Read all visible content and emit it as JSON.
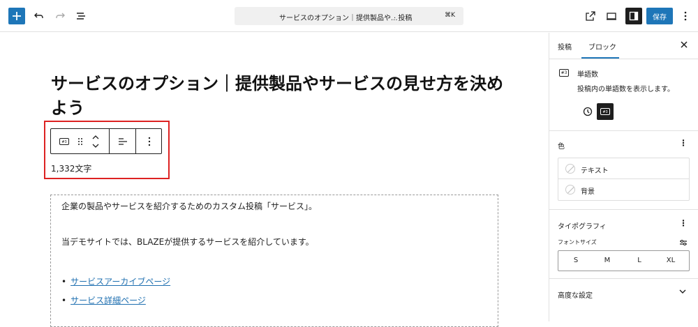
{
  "toolbar": {
    "document_title": "サービスのオプション｜提供製品や...",
    "document_type": "· 投稿",
    "shortcut": "⌘K",
    "save_label": "保存"
  },
  "editor": {
    "post_title": "サービスのオプション｜提供製品やサービスの見せ方を決めよう",
    "word_count": "1,332文字",
    "paragraphs": [
      "企業の製品やサービスを紹介するためのカスタム投稿「サービス」。",
      "当デモサイトでは、BLAZEが提供するサービスを紹介しています。"
    ],
    "list_items": [
      "サービスアーカイブページ",
      "サービス詳細ページ"
    ]
  },
  "sidebar": {
    "tabs": [
      "投稿",
      "ブロック"
    ],
    "active_tab": "ブロック",
    "block": {
      "title": "単語数",
      "description": "投稿内の単語数を表示します。"
    },
    "color": {
      "label": "色",
      "items": [
        "テキスト",
        "背景"
      ]
    },
    "typography": {
      "label": "タイポグラフィ",
      "font_size_label": "フォントサイズ",
      "sizes": [
        "S",
        "M",
        "L",
        "XL"
      ]
    },
    "advanced": {
      "label": "高度な設定"
    }
  },
  "colors": {
    "accent": "#1e76b8",
    "highlight": "#dd2222",
    "link": "#1e6fb0"
  }
}
